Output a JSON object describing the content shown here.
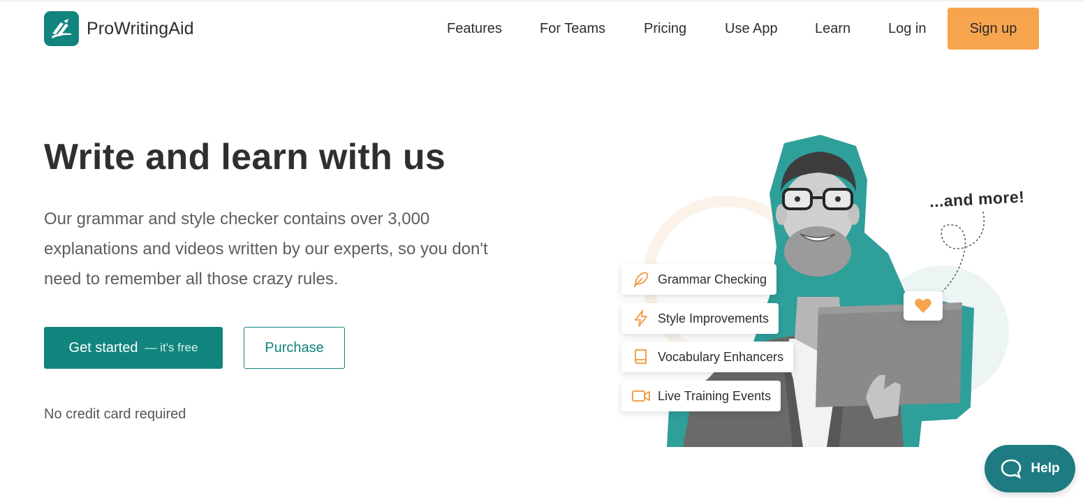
{
  "brand": {
    "name": "ProWritingAid",
    "accent": "#12847e",
    "cta": "#f6a44e"
  },
  "nav": {
    "links": [
      "Features",
      "For Teams",
      "Pricing",
      "Use App",
      "Learn",
      "Log in"
    ],
    "signup_label": "Sign up"
  },
  "hero": {
    "title": "Write and learn with us",
    "subtitle": "Our grammar and style checker contains over 3,000 explanations and videos written by our experts, so you don't need to remember all those crazy rules.",
    "primary_button": {
      "label": "Get started",
      "suffix": "— it's free"
    },
    "secondary_button": {
      "label": "Purchase"
    },
    "note": "No credit card required"
  },
  "illustration": {
    "features": [
      {
        "label": "Grammar Checking",
        "icon": "feather-icon"
      },
      {
        "label": "Style Improvements",
        "icon": "lightning-icon"
      },
      {
        "label": "Vocabulary Enhancers",
        "icon": "book-icon"
      },
      {
        "label": "Live Training Events",
        "icon": "video-camera-icon"
      }
    ],
    "more_label": "...and more!",
    "heart_icon": "heart-icon"
  },
  "help": {
    "label": "Help",
    "icon": "chat-bubble-icon"
  }
}
